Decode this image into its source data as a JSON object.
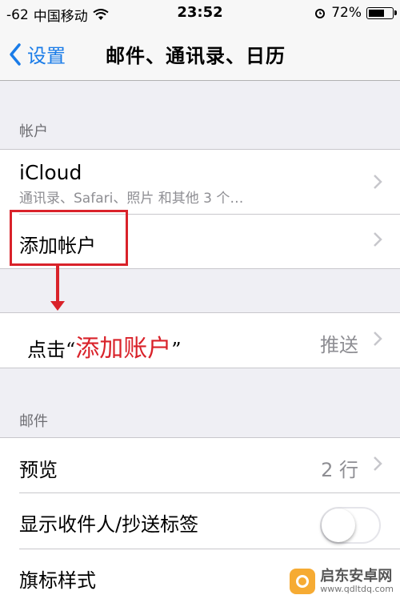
{
  "status_bar": {
    "signal": "-62",
    "carrier": "中国移动",
    "time": "23:52",
    "battery": "72%",
    "battery_level": 0.72
  },
  "nav": {
    "back_label": "设置",
    "title": "邮件、通讯录、日历"
  },
  "accounts_section": {
    "header": "帐户",
    "icloud_title": "iCloud",
    "icloud_subtitle": "通讯录、Safari、照片 和其他 3 个…",
    "add_account": "添加帐户"
  },
  "fetch_row": {
    "value": "推送"
  },
  "annotation": {
    "prefix": "点击“",
    "highlight": "添加账户",
    "suffix": "”"
  },
  "mail_section": {
    "header": "邮件",
    "preview_label": "预览",
    "preview_value": "2 行",
    "show_to_cc_label": "显示收件人/抄送标签",
    "show_to_cc_on": false,
    "flag_style_label": "旗标样式"
  },
  "watermark": {
    "name": "启东安卓网",
    "url": "www.qdltdq.com"
  },
  "colors": {
    "accent": "#1a7ce8",
    "annotation_red": "#d9222a",
    "background": "#efeff4"
  }
}
